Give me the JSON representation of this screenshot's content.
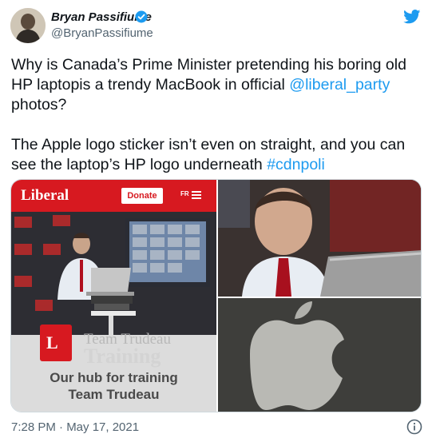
{
  "author": {
    "display_name": "Bryan Passifiume",
    "handle": "@BryanPassifiume",
    "verified_icon": "verified-badge-icon",
    "avatar_icon": "avatar"
  },
  "platform_icon": "twitter-bird-icon",
  "tweet": {
    "line1": "Why is Canada’s Prime Minister pretending his boring old HP laptopis a trendy MacBook in official ",
    "mention": "@liberal_party",
    "line1_end": " photos?",
    "line2": "The Apple logo sticker isn’t even on straight, and you can see the laptop’s HP logo underneath ",
    "hashtag": "#cdnpoli"
  },
  "media": {
    "left": {
      "site_logo": "Liberal",
      "donate_label": "Donate",
      "lang_label": "FR",
      "menu_icon": "hamburger-menu-icon",
      "team_label": "Team Trudeau",
      "training_label": "Training",
      "hub_line1": "Our hub for training",
      "hub_line2": "Team Trudeau"
    }
  },
  "timestamp": "7:28 PM · May 17, 2021",
  "info_icon": "info-icon",
  "colors": {
    "link": "#1d9bf0",
    "liberal_red": "#d71920",
    "text": "#0f1419",
    "secondary": "#536471"
  }
}
